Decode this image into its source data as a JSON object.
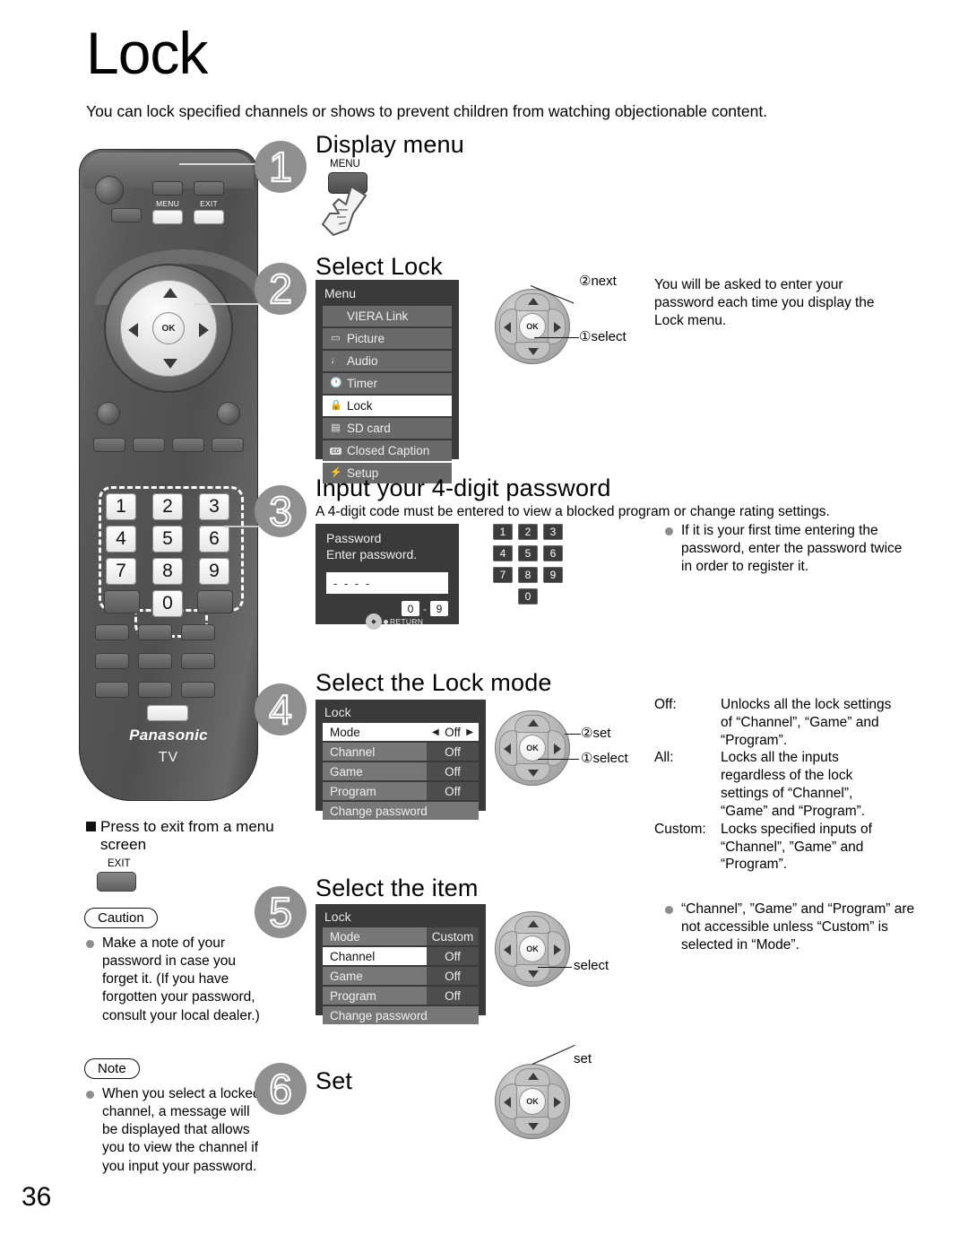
{
  "page": {
    "title": "Lock",
    "intro": "You can lock specified channels or shows to prevent children from watching objectionable content.",
    "page_number": "36"
  },
  "remote": {
    "brand": "Panasonic",
    "brand_sub": "TV",
    "menu_label": "MENU",
    "exit_label": "EXIT",
    "ok_label": "OK",
    "keys": [
      "1",
      "2",
      "3",
      "4",
      "5",
      "6",
      "7",
      "8",
      "9",
      "0"
    ]
  },
  "steps": [
    {
      "number": "1",
      "title": "Display menu",
      "button_label": "MENU"
    },
    {
      "number": "2",
      "title": "Select  Lock",
      "menu": {
        "header": "Menu",
        "items": [
          {
            "icon": "",
            "label": "VIERA Link",
            "selected": false
          },
          {
            "icon": "▭",
            "label": "Picture",
            "selected": false
          },
          {
            "icon": "♩",
            "label": "Audio",
            "selected": false
          },
          {
            "icon": "🕐",
            "label": "Timer",
            "selected": false
          },
          {
            "icon": "🔒",
            "label": "Lock",
            "selected": true
          },
          {
            "icon": "▤",
            "label": "SD card",
            "selected": false
          },
          {
            "icon": "cc",
            "label": "Closed Caption",
            "selected": false
          },
          {
            "icon": "⚡",
            "label": "Setup",
            "selected": false
          }
        ]
      },
      "pad_callouts": {
        "top": "②next",
        "bottom": "①select"
      },
      "note": "You will be asked to enter your password each time you display the Lock menu."
    },
    {
      "number": "3",
      "title": "Input your 4-digit password",
      "lead": "A 4-digit code must be entered to view a blocked program or change rating settings.",
      "dialog": {
        "header": "Password",
        "prompt": "Enter password.",
        "field_value": "- - - -",
        "range_from": "0",
        "range_dash": "-",
        "range_to": "9",
        "return_label": "RETURN"
      },
      "keypad": [
        "1",
        "2",
        "3",
        "4",
        "5",
        "6",
        "7",
        "8",
        "9",
        "0"
      ],
      "bullet": "If it is your first time entering the password, enter the password twice in order to register it."
    },
    {
      "number": "4",
      "title": "Select the Lock mode",
      "osd": {
        "header": "Lock",
        "rows": [
          {
            "label": "Mode",
            "value": "Off",
            "selected": true
          },
          {
            "label": "Channel",
            "value": "Off",
            "selected": false
          },
          {
            "label": "Game",
            "value": "Off",
            "selected": false
          },
          {
            "label": "Program",
            "value": "Off",
            "selected": false
          },
          {
            "label": "Change password",
            "value": "",
            "selected": false
          }
        ]
      },
      "pad_callouts": {
        "top": "②set",
        "bottom": "①select"
      },
      "definitions": [
        {
          "key": "Off:",
          "value": "Unlocks all the lock settings of “Channel”, “Game” and “Program”."
        },
        {
          "key": "All:",
          "value": "Locks all the inputs regardless of the lock settings of “Channel”, “Game” and “Program”."
        },
        {
          "key": "Custom:",
          "value": "Locks specified inputs of “Channel”, ”Game” and “Program”."
        }
      ]
    },
    {
      "number": "5",
      "title": "Select the item",
      "osd": {
        "header": "Lock",
        "rows": [
          {
            "label": "Mode",
            "value": "Custom",
            "selected": false
          },
          {
            "label": "Channel",
            "value": "Off",
            "selected": true
          },
          {
            "label": "Game",
            "value": "Off",
            "selected": false
          },
          {
            "label": "Program",
            "value": "Off",
            "selected": false
          },
          {
            "label": "Change password",
            "value": "",
            "selected": false
          }
        ]
      },
      "pad_callouts": {
        "bottom": "select"
      },
      "bullet": "“Channel”, ”Game” and “Program” are not accessible unless “Custom” is selected in “Mode”."
    },
    {
      "number": "6",
      "title": "Set",
      "pad_callouts": {
        "top": "set"
      }
    }
  ],
  "exit_section": {
    "heading": "Press to exit from a menu screen",
    "button_label": "EXIT"
  },
  "caution": {
    "tag": "Caution",
    "text": "Make a note of your password in case you forget it. (If you have forgotten your password, consult your local dealer.)"
  },
  "note": {
    "tag": "Note",
    "text": "When you select a locked channel, a message will be displayed that allows you to view the channel if you input your password."
  }
}
